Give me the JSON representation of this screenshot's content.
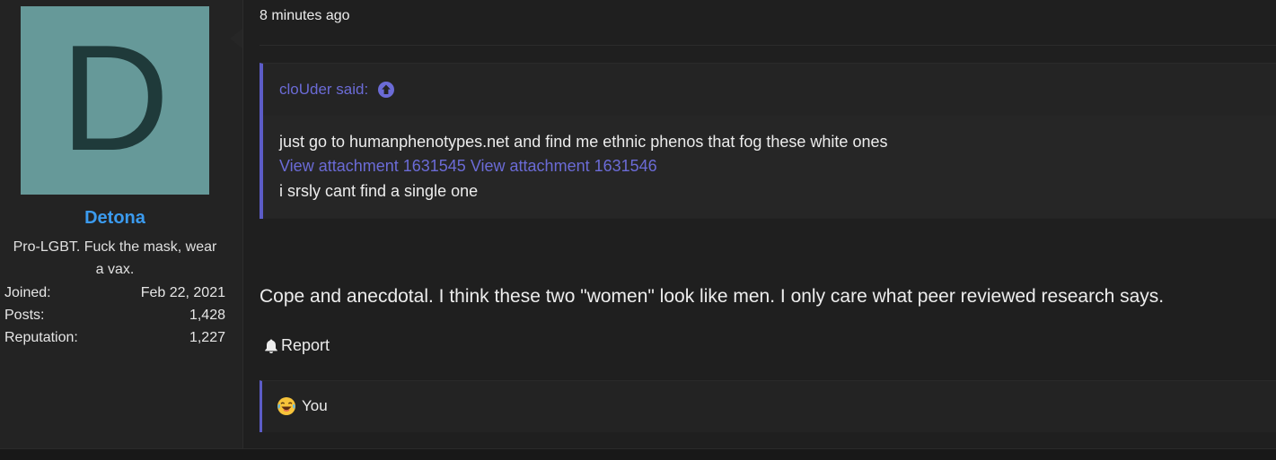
{
  "user": {
    "avatar_letter": "D",
    "avatar_color": "#669999",
    "name": "Detona",
    "name_color": "#3b9bef",
    "title": "Pro-LGBT. Fuck the mask, wear a vax.",
    "stats": [
      {
        "label": "Joined:",
        "value": "Feb 22, 2021"
      },
      {
        "label": "Posts:",
        "value": "1,428"
      },
      {
        "label": "Reputation:",
        "value": "1,227"
      }
    ]
  },
  "post": {
    "time": "8 minutes ago",
    "quote": {
      "author_said": "cloUder said:",
      "jump_icon": "arrow-up-circle-icon",
      "accent_color": "#5c5cc7",
      "line1": "just go to humanphenotypes.net and find me ethnic phenos that fog these white ones",
      "attachment1": "View attachment 1631545",
      "attachment2": "View attachment 1631546",
      "line3": "i srsly cant find a single one"
    },
    "body": "Cope and anecdotal. I think these two \"women\" look like men. I only care what peer reviewed research says.",
    "report_label": "Report",
    "report_icon": "bell-icon",
    "reaction": {
      "icon": "crying-laughing-emoji-icon",
      "who": "You"
    }
  }
}
